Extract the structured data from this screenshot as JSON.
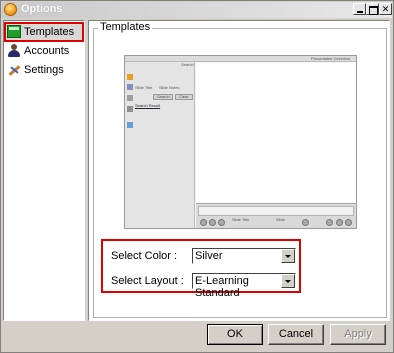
{
  "window": {
    "title": "Options"
  },
  "nav": {
    "items": [
      {
        "label": "Templates",
        "icon": "templates-icon",
        "selected": true
      },
      {
        "label": "Accounts",
        "icon": "accounts-icon",
        "selected": false
      },
      {
        "label": "Settings",
        "icon": "settings-icon",
        "selected": false
      }
    ]
  },
  "group": {
    "title": "Templates"
  },
  "preview": {
    "header_right": "Presentable Overview",
    "search_label": "Search",
    "option_left": "Slide Title",
    "option_right": "Slide Notes",
    "btn_search": "Search",
    "btn_clear": "Clear",
    "link": "Search Result",
    "ctrl_left": "Slide Title",
    "ctrl_mid": "Slide"
  },
  "form": {
    "color_label": "Select Color :",
    "color_value": "Silver",
    "layout_label": "Select Layout :",
    "layout_value": "E-Learning Standard",
    "highlight_color": "#e00000"
  },
  "buttons": {
    "ok": "OK",
    "cancel": "Cancel",
    "apply": "Apply"
  }
}
